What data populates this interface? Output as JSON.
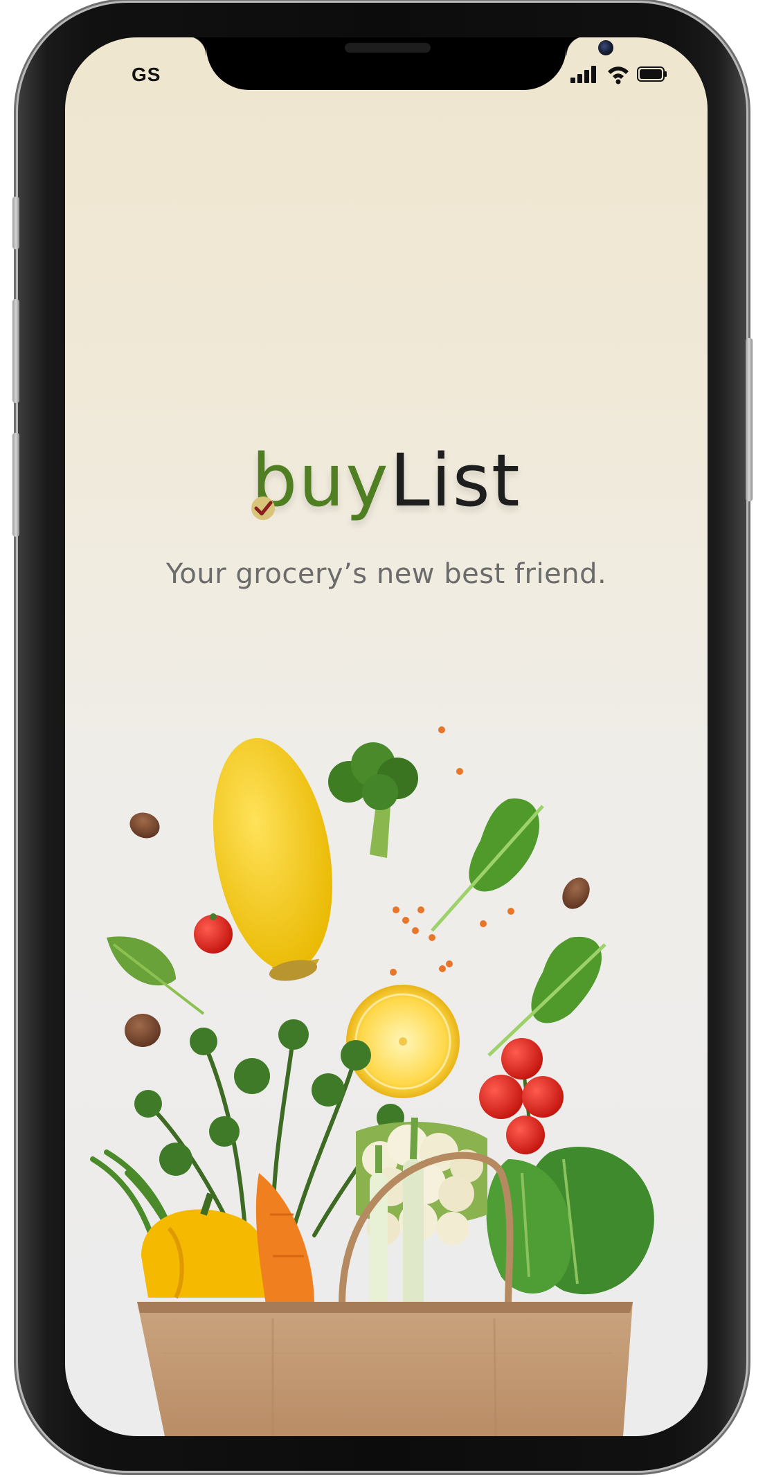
{
  "status_bar": {
    "carrier": "GS",
    "icons": [
      "signal-icon",
      "wifi-icon",
      "battery-icon"
    ]
  },
  "app": {
    "logo_part1": "buy",
    "logo_part2": "List",
    "tagline": "Your grocery’s new best friend."
  },
  "colors": {
    "brand_green": "#4f7f22",
    "logo_dark": "#1e1e1e",
    "tagline_gray": "#6b6b6b",
    "background_top": "#efe6cf",
    "background_bottom": "#ececec"
  },
  "illustration": {
    "subject": "paper grocery bag with vegetables"
  }
}
